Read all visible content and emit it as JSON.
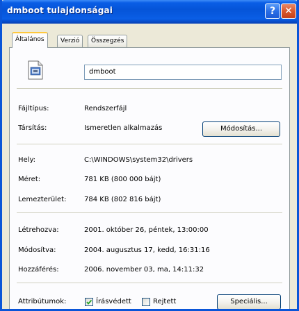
{
  "window": {
    "title": "dmboot tulajdonságai",
    "help_label": "?",
    "close_label": "✕"
  },
  "tabs": [
    {
      "label": "Általános",
      "active": true
    },
    {
      "label": "Verzió",
      "active": false
    },
    {
      "label": "Összegzés",
      "active": false
    }
  ],
  "general": {
    "file_icon": "system-file-icon",
    "file_name": "dmboot",
    "file_type_label": "Fájltípus:",
    "file_type_value": "Rendszerfájl",
    "opens_with_label": "Társítás:",
    "opens_with_value": "Ismeretlen alkalmazás",
    "change_button": "Módosítás...",
    "location_label": "Hely:",
    "location_value": "C:\\WINDOWS\\system32\\drivers",
    "size_label": "Méret:",
    "size_value": "781 KB (800 000 bájt)",
    "size_on_disk_label": "Lemezterület:",
    "size_on_disk_value": "784 KB (802 816 bájt)",
    "created_label": "Létrehozva:",
    "created_value": "2001. október 26, péntek, 13:00:00",
    "modified_label": "Módosítva:",
    "modified_value": "2004. augusztus 17, kedd, 16:31:16",
    "accessed_label": "Hozzáférés:",
    "accessed_value": "2006. november 03, ma, 14:11:32",
    "attributes_label": "Attribútumok:",
    "readonly_label": "Írásvédett",
    "readonly_checked": true,
    "hidden_label": "Rejtett",
    "hidden_checked": false,
    "advanced_button": "Speciális..."
  }
}
